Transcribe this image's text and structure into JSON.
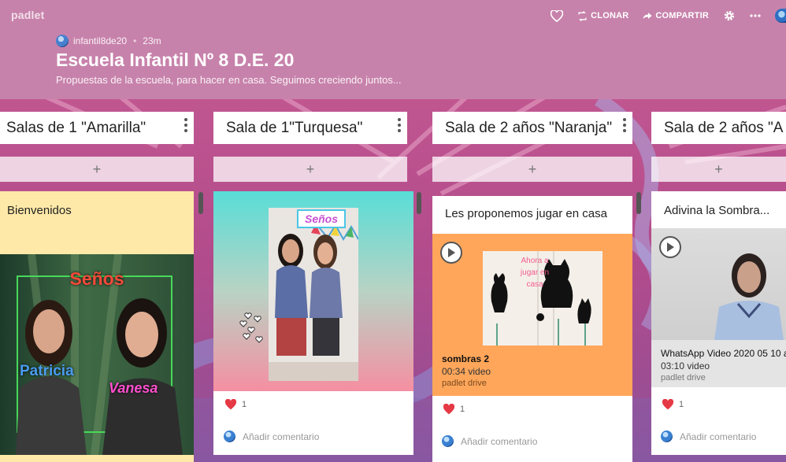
{
  "app": {
    "logo": "padlet"
  },
  "header": {
    "author": "infantil8de20",
    "time_ago": "23m",
    "title": "Escuela Infantil Nº 8 D.E. 20",
    "subtitle": "Propuestas de la escuela, para hacer en casa. Seguimos creciendo juntos...",
    "actions": {
      "clone_label": "CLONAR",
      "share_label": "COMPARTIR"
    },
    "icons": [
      "heart-icon",
      "clone-icon",
      "share-icon",
      "gear-icon",
      "more-icon"
    ]
  },
  "columns": [
    {
      "title": "Salas de 1 \"Amarilla\""
    },
    {
      "title": "Sala de 1\"Turquesa\""
    },
    {
      "title": "Sala de 2 años \"Naranja\""
    },
    {
      "title": "Sala de 2 años \"A"
    }
  ],
  "add_symbol": "+",
  "posts": {
    "bienvenidos": {
      "title": "Bienvenidos",
      "image_text": {
        "heading": "Seños",
        "name1": "Patricia",
        "name2": "Vanesa"
      }
    },
    "turquesa": {
      "image_text": {
        "heading": "Seños"
      },
      "likes": "1",
      "comment_placeholder": "Añadir comentario"
    },
    "naranja": {
      "title": "Les proponemos jugar en casa",
      "image_text": {
        "caption": "Ahora a jugar en casa"
      },
      "attachment_name": "sombras 2",
      "attachment_meta": "00:34 video",
      "attachment_source": "padlet drive",
      "likes": "1",
      "comment_placeholder": "Añadir comentario"
    },
    "adivina": {
      "title": "Adivina la Sombra...",
      "attachment_name": "WhatsApp Video 2020 05 10 a",
      "attachment_meta": "03:10 video",
      "attachment_source": "padlet drive",
      "likes": "1",
      "comment_placeholder": "Añadir comentario"
    }
  },
  "colors": {
    "header_bg": "#c782ab",
    "bienvenidos_card": "#ffe9a8",
    "naranja_card": "#ffa65a",
    "heart": "#e53945"
  }
}
